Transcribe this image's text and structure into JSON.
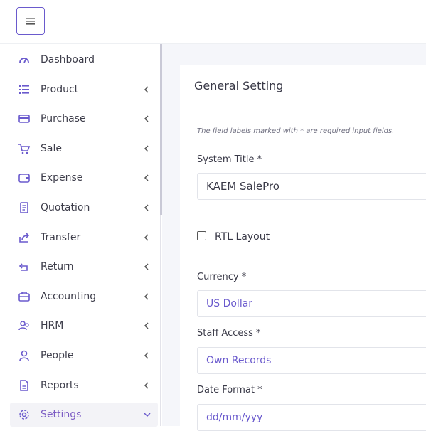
{
  "topbar": {
    "menu_icon": "hamburger-icon"
  },
  "sidebar": {
    "items": [
      {
        "label": "Dashboard",
        "icon": "dashboard-gauge-icon",
        "has_caret": false
      },
      {
        "label": "Product",
        "icon": "list-icon",
        "has_caret": true
      },
      {
        "label": "Purchase",
        "icon": "card-icon",
        "has_caret": true
      },
      {
        "label": "Sale",
        "icon": "cart-icon",
        "has_caret": true
      },
      {
        "label": "Expense",
        "icon": "wallet-icon",
        "has_caret": true
      },
      {
        "label": "Quotation",
        "icon": "document-icon",
        "has_caret": true
      },
      {
        "label": "Transfer",
        "icon": "share-icon",
        "has_caret": true
      },
      {
        "label": "Return",
        "icon": "return-icon",
        "has_caret": true
      },
      {
        "label": "Accounting",
        "icon": "briefcase-icon",
        "has_caret": true
      },
      {
        "label": "HRM",
        "icon": "users-icon",
        "has_caret": true
      },
      {
        "label": "People",
        "icon": "user-icon",
        "has_caret": true
      },
      {
        "label": "Reports",
        "icon": "report-file-icon",
        "has_caret": true
      },
      {
        "label": "Settings",
        "icon": "gear-icon",
        "has_caret": true,
        "active": true
      }
    ]
  },
  "main": {
    "title": "General Setting",
    "note": "The field labels marked with * are required input fields.",
    "fields": {
      "system_title": {
        "label": "System Title *",
        "value": "KAEM SalePro"
      },
      "rtl": {
        "label": "RTL Layout",
        "checked": false
      },
      "currency": {
        "label": "Currency *",
        "value": "US Dollar"
      },
      "staff_access": {
        "label": "Staff Access *",
        "value": "Own Records"
      },
      "date_format": {
        "label": "Date Format *",
        "value": "dd/mm/yyy"
      }
    }
  },
  "colors": {
    "accent": "#6a5acd",
    "active_text": "#7c5cc4",
    "content_bg": "#f5f6fa"
  }
}
